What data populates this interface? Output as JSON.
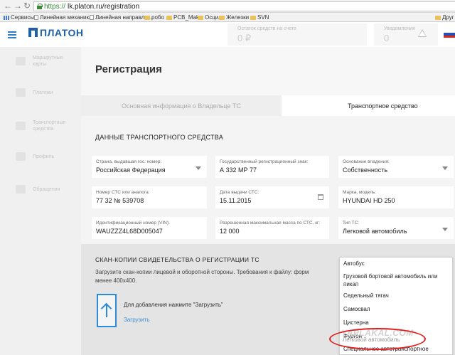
{
  "browser": {
    "url_scheme": "https://",
    "url_rest": "lk.platon.ru/registration",
    "back_glyph": "←",
    "forward_glyph": "→",
    "reload_glyph": "↻",
    "bookmarks": [
      {
        "label": "Сервисы",
        "icon": "apps-grid-icon"
      },
      {
        "label": "Линейная механика, ...",
        "icon": "page-icon"
      },
      {
        "label": "Линейная направля...",
        "icon": "page-icon"
      },
      {
        "label": "робо",
        "icon": "folder-icon"
      },
      {
        "label": "PCB_Make",
        "icon": "folder-icon"
      },
      {
        "label": "Осцил",
        "icon": "folder-icon"
      },
      {
        "label": "Железки",
        "icon": "folder-icon"
      },
      {
        "label": "SVN",
        "icon": "folder-icon"
      },
      {
        "label": "Друг",
        "icon": "folder-icon"
      }
    ]
  },
  "header": {
    "logo_text": "ПЛАТОН",
    "card1_label": "Остаток средств на счете",
    "card1_value": "0 ₽",
    "card2_label": "Уведомления",
    "card2_value": "0",
    "flag_colors": [
      "#ffffff",
      "#2a4fb0",
      "#d52b1e"
    ]
  },
  "sidebar": {
    "items": [
      {
        "label": "Маршрутные карты",
        "icon": "route-icon"
      },
      {
        "label": "Платежи",
        "icon": "payments-icon"
      },
      {
        "label": "Транспортные средства",
        "icon": "truck-icon"
      },
      {
        "label": "Профиль",
        "icon": "profile-icon"
      },
      {
        "label": "Обращения",
        "icon": "messages-icon"
      }
    ]
  },
  "page": {
    "title": "Регистрация",
    "tabs": [
      {
        "label": "Основная информация о Владельце ТС",
        "active": false
      },
      {
        "label": "Транспортное средство",
        "active": true
      }
    ],
    "section_title": "ДАННЫЕ ТРАНСПОРТНОГО СРЕДСТВА"
  },
  "fields": {
    "country": {
      "label": "Страна, выдавшая гос. номер:",
      "value": "Российская Федерация"
    },
    "plate": {
      "label": "Государственный регистрационный знак:",
      "value": "А 332 МР 77"
    },
    "ownership": {
      "label": "Основание владения:",
      "value": "Собственность"
    },
    "sts_number": {
      "label": "Номер СТС или аналога:",
      "value": "77 32 № 539708"
    },
    "sts_date": {
      "label": "Дата выдачи СТС:",
      "value": "15.11.2015"
    },
    "model": {
      "label": "Марка, модель:",
      "value": "HYUNDAI HD 250"
    },
    "vin": {
      "label": "Идентификационный номер (VIN):",
      "value": "WAUZZZ4L68D005047"
    },
    "max_mass": {
      "label": "Разрешенная максимальная масса по СТС, кг:",
      "value": "12 000"
    },
    "vehicle_type": {
      "label": "Тип ТС:",
      "value": "Легковой автомобиль"
    }
  },
  "scan": {
    "title": "СКАН-КОПИИ СВИДЕТЕЛЬСТВА О РЕГИСТРАЦИИ ТС",
    "desc_line1": "Загрузите скан-копии лицевой и оборотной стороны. Требования к файлу: форм",
    "desc_line2": "менее 400х400.",
    "upload_hint": "Для добавления нажмите \"Загрузить\"",
    "upload_link": "Загрузить"
  },
  "dropdown": {
    "options": [
      "Автобус",
      "Грузовой бортовой автомобиль или пикап",
      "Седельный тягач",
      "Самосвал",
      "Цистерна",
      "Фургон",
      "Специальное автотранспортное средство",
      "Легковой автомобиль"
    ]
  },
  "watermark": "YAPLAKAL.COM",
  "annotation_color": "#e02020"
}
